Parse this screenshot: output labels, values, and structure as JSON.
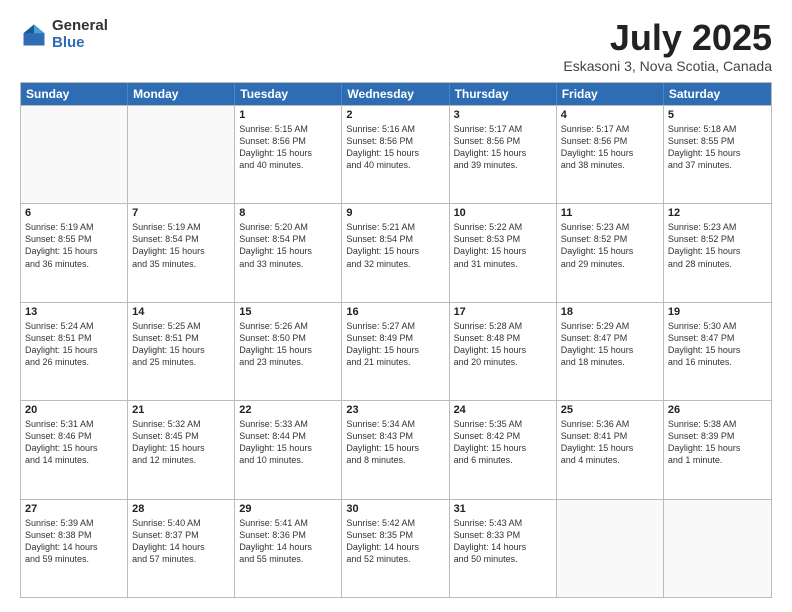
{
  "logo": {
    "general": "General",
    "blue": "Blue"
  },
  "header": {
    "month": "July 2025",
    "location": "Eskasoni 3, Nova Scotia, Canada"
  },
  "weekdays": [
    "Sunday",
    "Monday",
    "Tuesday",
    "Wednesday",
    "Thursday",
    "Friday",
    "Saturday"
  ],
  "weeks": [
    [
      {
        "day": "",
        "lines": []
      },
      {
        "day": "",
        "lines": []
      },
      {
        "day": "1",
        "lines": [
          "Sunrise: 5:15 AM",
          "Sunset: 8:56 PM",
          "Daylight: 15 hours",
          "and 40 minutes."
        ]
      },
      {
        "day": "2",
        "lines": [
          "Sunrise: 5:16 AM",
          "Sunset: 8:56 PM",
          "Daylight: 15 hours",
          "and 40 minutes."
        ]
      },
      {
        "day": "3",
        "lines": [
          "Sunrise: 5:17 AM",
          "Sunset: 8:56 PM",
          "Daylight: 15 hours",
          "and 39 minutes."
        ]
      },
      {
        "day": "4",
        "lines": [
          "Sunrise: 5:17 AM",
          "Sunset: 8:56 PM",
          "Daylight: 15 hours",
          "and 38 minutes."
        ]
      },
      {
        "day": "5",
        "lines": [
          "Sunrise: 5:18 AM",
          "Sunset: 8:55 PM",
          "Daylight: 15 hours",
          "and 37 minutes."
        ]
      }
    ],
    [
      {
        "day": "6",
        "lines": [
          "Sunrise: 5:19 AM",
          "Sunset: 8:55 PM",
          "Daylight: 15 hours",
          "and 36 minutes."
        ]
      },
      {
        "day": "7",
        "lines": [
          "Sunrise: 5:19 AM",
          "Sunset: 8:54 PM",
          "Daylight: 15 hours",
          "and 35 minutes."
        ]
      },
      {
        "day": "8",
        "lines": [
          "Sunrise: 5:20 AM",
          "Sunset: 8:54 PM",
          "Daylight: 15 hours",
          "and 33 minutes."
        ]
      },
      {
        "day": "9",
        "lines": [
          "Sunrise: 5:21 AM",
          "Sunset: 8:54 PM",
          "Daylight: 15 hours",
          "and 32 minutes."
        ]
      },
      {
        "day": "10",
        "lines": [
          "Sunrise: 5:22 AM",
          "Sunset: 8:53 PM",
          "Daylight: 15 hours",
          "and 31 minutes."
        ]
      },
      {
        "day": "11",
        "lines": [
          "Sunrise: 5:23 AM",
          "Sunset: 8:52 PM",
          "Daylight: 15 hours",
          "and 29 minutes."
        ]
      },
      {
        "day": "12",
        "lines": [
          "Sunrise: 5:23 AM",
          "Sunset: 8:52 PM",
          "Daylight: 15 hours",
          "and 28 minutes."
        ]
      }
    ],
    [
      {
        "day": "13",
        "lines": [
          "Sunrise: 5:24 AM",
          "Sunset: 8:51 PM",
          "Daylight: 15 hours",
          "and 26 minutes."
        ]
      },
      {
        "day": "14",
        "lines": [
          "Sunrise: 5:25 AM",
          "Sunset: 8:51 PM",
          "Daylight: 15 hours",
          "and 25 minutes."
        ]
      },
      {
        "day": "15",
        "lines": [
          "Sunrise: 5:26 AM",
          "Sunset: 8:50 PM",
          "Daylight: 15 hours",
          "and 23 minutes."
        ]
      },
      {
        "day": "16",
        "lines": [
          "Sunrise: 5:27 AM",
          "Sunset: 8:49 PM",
          "Daylight: 15 hours",
          "and 21 minutes."
        ]
      },
      {
        "day": "17",
        "lines": [
          "Sunrise: 5:28 AM",
          "Sunset: 8:48 PM",
          "Daylight: 15 hours",
          "and 20 minutes."
        ]
      },
      {
        "day": "18",
        "lines": [
          "Sunrise: 5:29 AM",
          "Sunset: 8:47 PM",
          "Daylight: 15 hours",
          "and 18 minutes."
        ]
      },
      {
        "day": "19",
        "lines": [
          "Sunrise: 5:30 AM",
          "Sunset: 8:47 PM",
          "Daylight: 15 hours",
          "and 16 minutes."
        ]
      }
    ],
    [
      {
        "day": "20",
        "lines": [
          "Sunrise: 5:31 AM",
          "Sunset: 8:46 PM",
          "Daylight: 15 hours",
          "and 14 minutes."
        ]
      },
      {
        "day": "21",
        "lines": [
          "Sunrise: 5:32 AM",
          "Sunset: 8:45 PM",
          "Daylight: 15 hours",
          "and 12 minutes."
        ]
      },
      {
        "day": "22",
        "lines": [
          "Sunrise: 5:33 AM",
          "Sunset: 8:44 PM",
          "Daylight: 15 hours",
          "and 10 minutes."
        ]
      },
      {
        "day": "23",
        "lines": [
          "Sunrise: 5:34 AM",
          "Sunset: 8:43 PM",
          "Daylight: 15 hours",
          "and 8 minutes."
        ]
      },
      {
        "day": "24",
        "lines": [
          "Sunrise: 5:35 AM",
          "Sunset: 8:42 PM",
          "Daylight: 15 hours",
          "and 6 minutes."
        ]
      },
      {
        "day": "25",
        "lines": [
          "Sunrise: 5:36 AM",
          "Sunset: 8:41 PM",
          "Daylight: 15 hours",
          "and 4 minutes."
        ]
      },
      {
        "day": "26",
        "lines": [
          "Sunrise: 5:38 AM",
          "Sunset: 8:39 PM",
          "Daylight: 15 hours",
          "and 1 minute."
        ]
      }
    ],
    [
      {
        "day": "27",
        "lines": [
          "Sunrise: 5:39 AM",
          "Sunset: 8:38 PM",
          "Daylight: 14 hours",
          "and 59 minutes."
        ]
      },
      {
        "day": "28",
        "lines": [
          "Sunrise: 5:40 AM",
          "Sunset: 8:37 PM",
          "Daylight: 14 hours",
          "and 57 minutes."
        ]
      },
      {
        "day": "29",
        "lines": [
          "Sunrise: 5:41 AM",
          "Sunset: 8:36 PM",
          "Daylight: 14 hours",
          "and 55 minutes."
        ]
      },
      {
        "day": "30",
        "lines": [
          "Sunrise: 5:42 AM",
          "Sunset: 8:35 PM",
          "Daylight: 14 hours",
          "and 52 minutes."
        ]
      },
      {
        "day": "31",
        "lines": [
          "Sunrise: 5:43 AM",
          "Sunset: 8:33 PM",
          "Daylight: 14 hours",
          "and 50 minutes."
        ]
      },
      {
        "day": "",
        "lines": []
      },
      {
        "day": "",
        "lines": []
      }
    ]
  ]
}
